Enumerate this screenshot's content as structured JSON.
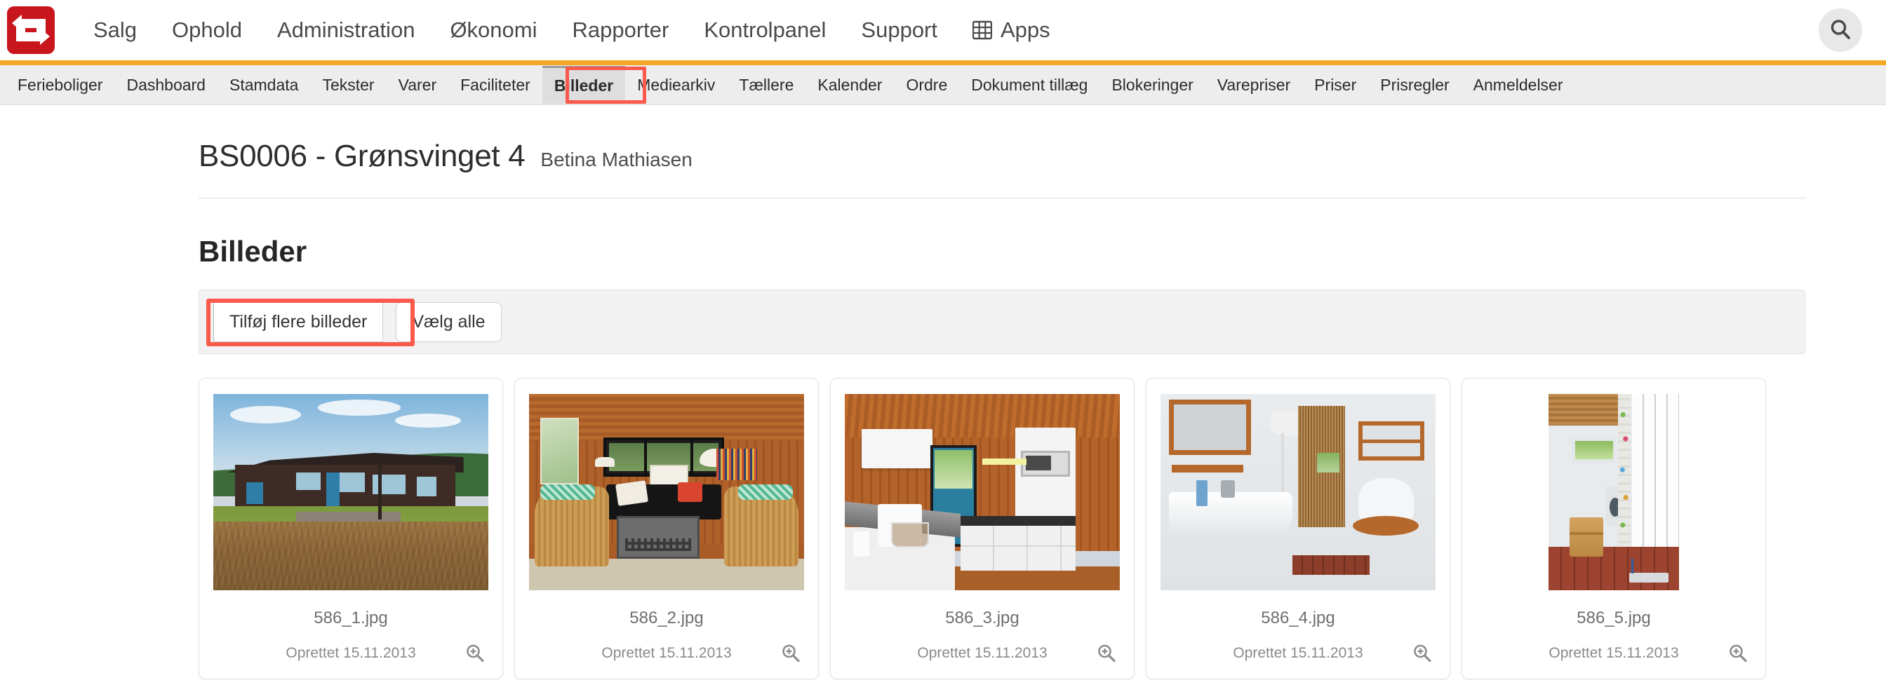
{
  "brand": {
    "logo_name": "smartcrm-logo",
    "accent_red": "#c9161c",
    "accent_orange": "#f5a623",
    "highlight_red": "#fa5a4b"
  },
  "topnav": {
    "items": [
      {
        "label": "Salg"
      },
      {
        "label": "Ophold"
      },
      {
        "label": "Administration"
      },
      {
        "label": "Økonomi"
      },
      {
        "label": "Rapporter"
      },
      {
        "label": "Kontrolpanel"
      },
      {
        "label": "Support"
      },
      {
        "label": "Apps",
        "icon": "grid-icon"
      }
    ],
    "search_icon": "search-icon"
  },
  "subnav": {
    "items": [
      {
        "label": "Ferieboliger",
        "active": false
      },
      {
        "label": "Dashboard",
        "active": false
      },
      {
        "label": "Stamdata",
        "active": false
      },
      {
        "label": "Tekster",
        "active": false
      },
      {
        "label": "Varer",
        "active": false
      },
      {
        "label": "Faciliteter",
        "active": false
      },
      {
        "label": "Billeder",
        "active": true
      },
      {
        "label": "Mediearkiv",
        "active": false
      },
      {
        "label": "Tællere",
        "active": false
      },
      {
        "label": "Kalender",
        "active": false
      },
      {
        "label": "Ordre",
        "active": false
      },
      {
        "label": "Dokument tillæg",
        "active": false
      },
      {
        "label": "Blokeringer",
        "active": false
      },
      {
        "label": "Varepriser",
        "active": false
      },
      {
        "label": "Priser",
        "active": false
      },
      {
        "label": "Prisregler",
        "active": false
      },
      {
        "label": "Anmeldelser",
        "active": false
      }
    ]
  },
  "header": {
    "title": "BS0006 - Grønsvinget 4",
    "owner": "Betina Mathiasen"
  },
  "main": {
    "section_title": "Billeder",
    "toolbar": {
      "add_images_label": "Tilføj flere billeder",
      "select_all_label": "Vælg alle"
    },
    "cards": [
      {
        "filename": "586_1.jpg",
        "created": "Oprettet 15.11.2013",
        "orientation": "landscape",
        "zoom_icon": "zoom-in-icon",
        "alt": "Exterior of dark brown wooden summer house with pine trees and heather"
      },
      {
        "filename": "586_2.jpg",
        "created": "Oprettet 15.11.2013",
        "orientation": "landscape",
        "zoom_icon": "zoom-in-icon",
        "alt": "Wood panelled living room with wicker chairs, black sofa and coffee table"
      },
      {
        "filename": "586_3.jpg",
        "created": "Oprettet 15.11.2013",
        "orientation": "landscape",
        "zoom_icon": "zoom-in-icon",
        "alt": "Kitchen with white cabinets, microwave, coffee maker and blue stable door"
      },
      {
        "filename": "586_4.jpg",
        "created": "Oprettet 15.11.2013",
        "orientation": "landscape",
        "zoom_icon": "zoom-in-icon",
        "alt": "Bathroom with white sink, wooden toilet seat and beaded shower curtain"
      },
      {
        "filename": "586_5.jpg",
        "created": "Oprettet 15.11.2013",
        "orientation": "portrait",
        "zoom_icon": "zoom-in-icon",
        "alt": "Utility shower room with wooden stool, tiled wall and red floor tiles"
      }
    ]
  }
}
